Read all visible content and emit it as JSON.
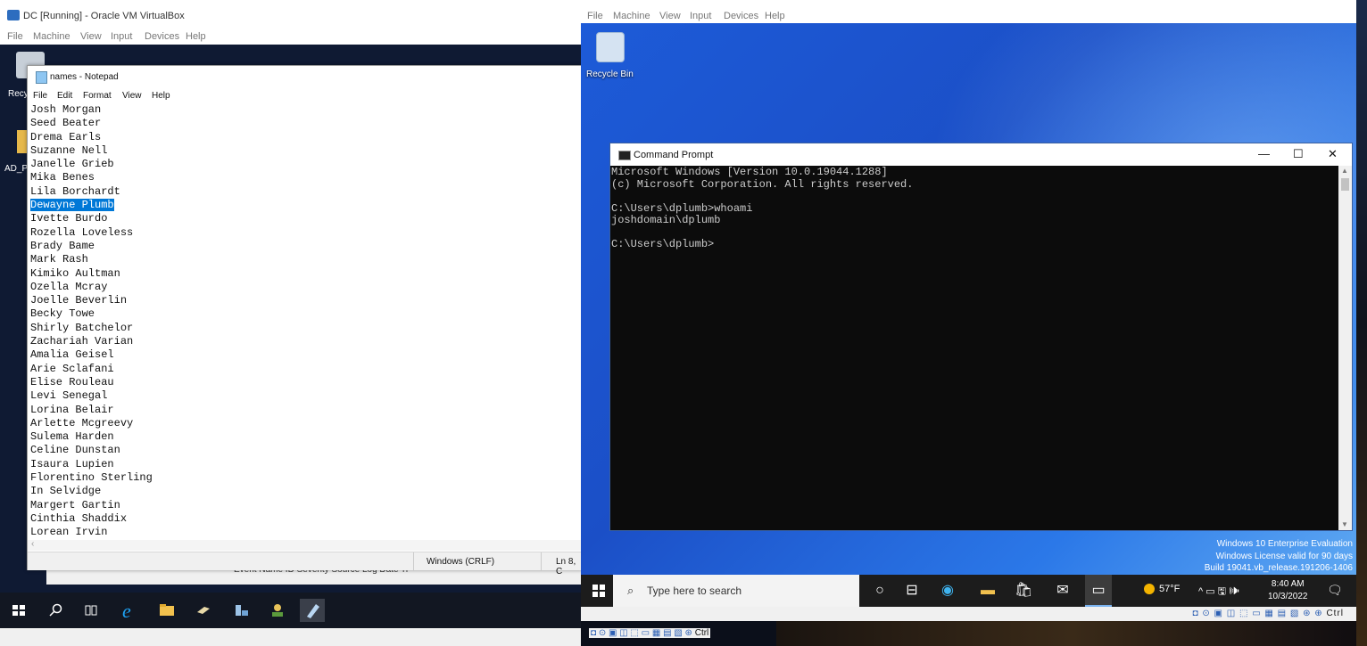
{
  "left_vm": {
    "window_title": "DC [Running] - Oracle VM VirtualBox",
    "menu": [
      "File",
      "Machine",
      "View",
      "Input",
      "Devices",
      "Help"
    ],
    "desktop": {
      "recycle_label": "Recy",
      "folder_label": "AD_P"
    },
    "notepad": {
      "title": "names - Notepad",
      "menu": [
        "File",
        "Edit",
        "Format",
        "View",
        "Help"
      ],
      "lines": [
        "Josh Morgan",
        "Seed Beater",
        "Drema Earls",
        "Suzanne Nell",
        "Janelle Grieb",
        "Mika Benes",
        "Lila Borchardt",
        "Dewayne Plumb",
        "Ivette Burdo",
        "Rozella Loveless",
        "Brady Bame",
        "Mark Rash",
        "Kimiko Aultman",
        "Ozella Mcray",
        "Joelle Beverlin",
        "Becky Towe",
        "Shirly Batchelor",
        "Zachariah Varian",
        "Amalia Geisel",
        "Arie Sclafani",
        "Elise Rouleau",
        "Levi Senegal",
        "Lorina Belair",
        "Arlette Mcgreevy",
        "Sulema Harden",
        "Celine Dunstan",
        "Isaura Lupien",
        "Florentino Sterling",
        "In Selvidge",
        "Margert Gartin",
        "Cinthia Shaddix",
        "Lorean Irvin"
      ],
      "selected_line_index": 7,
      "status_encoding": "Windows (CRLF)",
      "status_position": "Ln 8, C"
    },
    "behind_window_text": "Event Name   ID     Severity  Source                              Log    Date Ti",
    "taskbar_icons": [
      "windows-start-icon",
      "search-icon",
      "task-view-icon",
      "internet-explorer-icon",
      "file-explorer-icon",
      "server-manager-icon",
      "ad-users-icon",
      "user-icon",
      "notepad-icon"
    ]
  },
  "right_vm": {
    "menu": [
      "File",
      "Machine",
      "View",
      "Input",
      "Devices",
      "Help"
    ],
    "recycle_label": "Recycle Bin",
    "cmd": {
      "title": "Command Prompt",
      "minimize": "—",
      "maximize": "☐",
      "close": "✕",
      "output": "Microsoft Windows [Version 10.0.19044.1288]\n(c) Microsoft Corporation. All rights reserved.\n\nC:\\Users\\dplumb>whoami\njoshdomain\\dplumb\n\nC:\\Users\\dplumb>"
    },
    "watermark": [
      "Windows 10 Enterprise Evaluation",
      "Windows License valid for 90 days",
      "Build 19041.vb_release.191206-1406"
    ],
    "taskbar": {
      "search_placeholder": "Type here to search",
      "weather": "57°F",
      "tray": "^ ▭ 🖫 🕪",
      "time": "8:40 AM",
      "date": "10/3/2022"
    },
    "status_ctrl": "Ctrl"
  },
  "left_status_ctrl": "Ctrl"
}
